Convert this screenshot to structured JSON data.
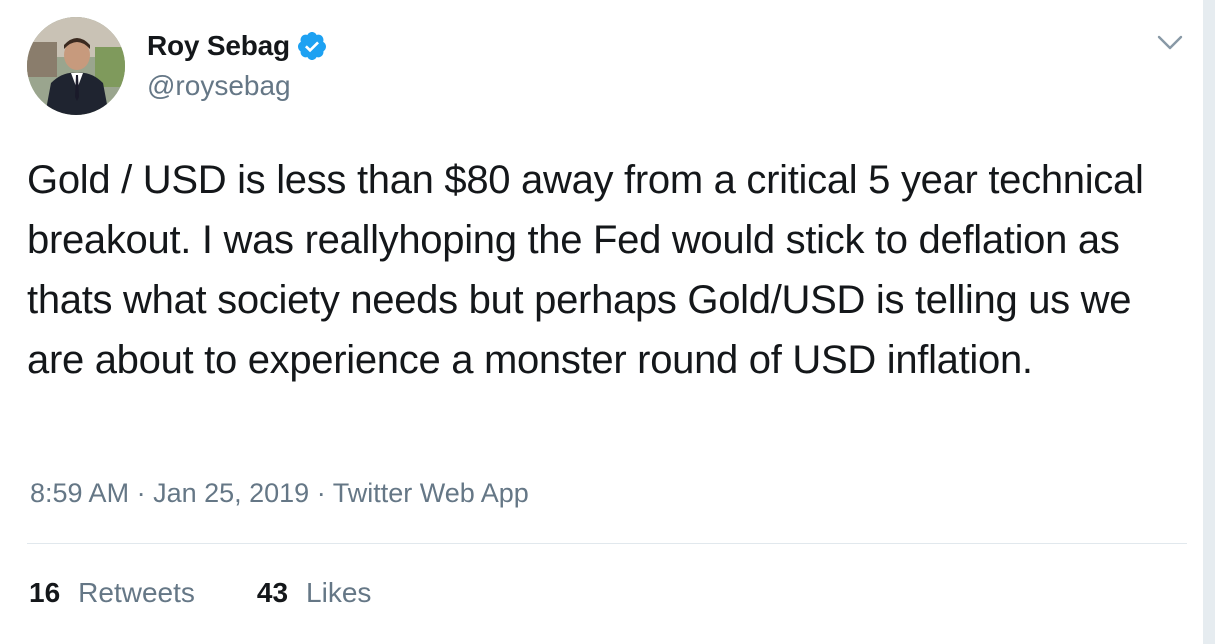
{
  "author": {
    "display_name": "Roy Sebag",
    "handle": "@roysebag",
    "verified": true
  },
  "tweet": {
    "text": "Gold / USD is less than $80 away from a critical 5 year technical breakout. I was reallyhoping the Fed would stick to deflation as thats what society needs but perhaps Gold/USD is telling us we are about to experience a monster round of USD inflation.",
    "time": "8:59 AM",
    "date": "Jan 25, 2019",
    "source": "Twitter Web App",
    "separator": " · "
  },
  "stats": {
    "retweets_count": "16",
    "retweets_label": "Retweets",
    "likes_count": "43",
    "likes_label": "Likes"
  },
  "icons": {
    "verified": "verified-badge-icon",
    "menu": "chevron-down-icon"
  },
  "colors": {
    "verified_blue": "#1da1f2",
    "text_primary": "#14171a",
    "text_secondary": "#657786",
    "divider": "#e1e8ed"
  }
}
